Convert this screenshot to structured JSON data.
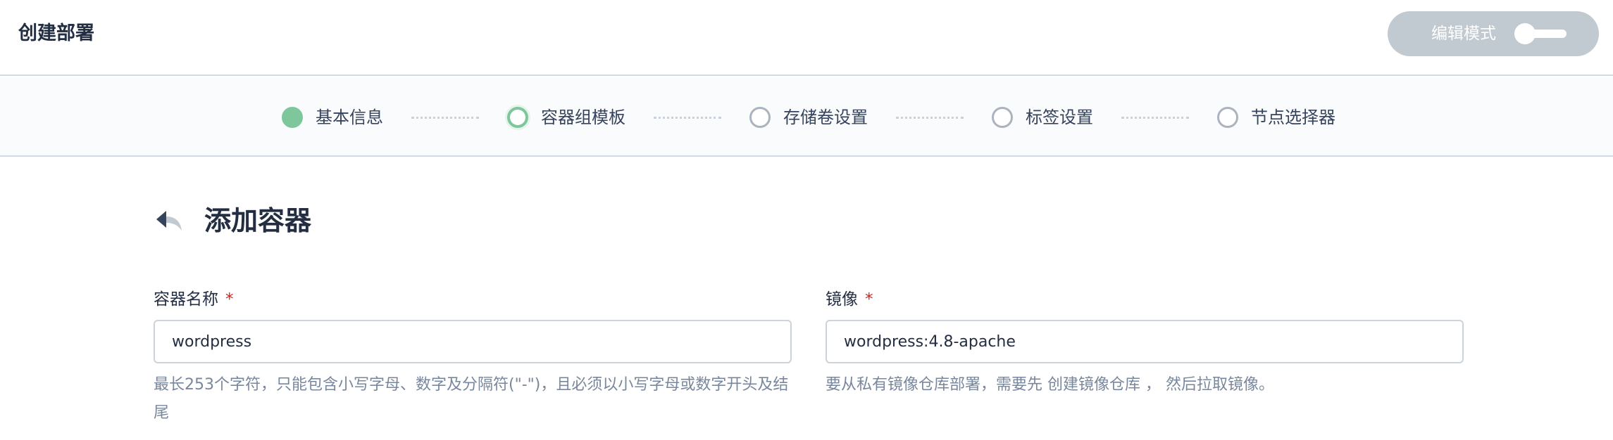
{
  "header": {
    "title": "创建部署",
    "edit_mode_label": "编辑模式",
    "edit_mode_on": false
  },
  "steps": [
    {
      "label": "基本信息",
      "state": "done"
    },
    {
      "label": "容器组模板",
      "state": "active"
    },
    {
      "label": "存储卷设置",
      "state": "pending"
    },
    {
      "label": "标签设置",
      "state": "pending"
    },
    {
      "label": "节点选择器",
      "state": "pending"
    }
  ],
  "section": {
    "title": "添加容器"
  },
  "form": {
    "container_name": {
      "label": "容器名称",
      "required_mark": "*",
      "value": "wordpress",
      "description": "最长253个字符，只能包含小写字母、数字及分隔符(\"-\")，且必须以小写字母或数字开头及结尾"
    },
    "image": {
      "label": "镜像",
      "required_mark": "*",
      "value": "wordpress:4.8-apache",
      "description": "要从私有镜像仓库部署，需要先 创建镜像仓库 ， 然后拉取镜像。"
    }
  },
  "colors": {
    "accent_green": "#7ec79b",
    "required_red": "#ca2621",
    "toggle_bg": "#c1c9d1"
  }
}
